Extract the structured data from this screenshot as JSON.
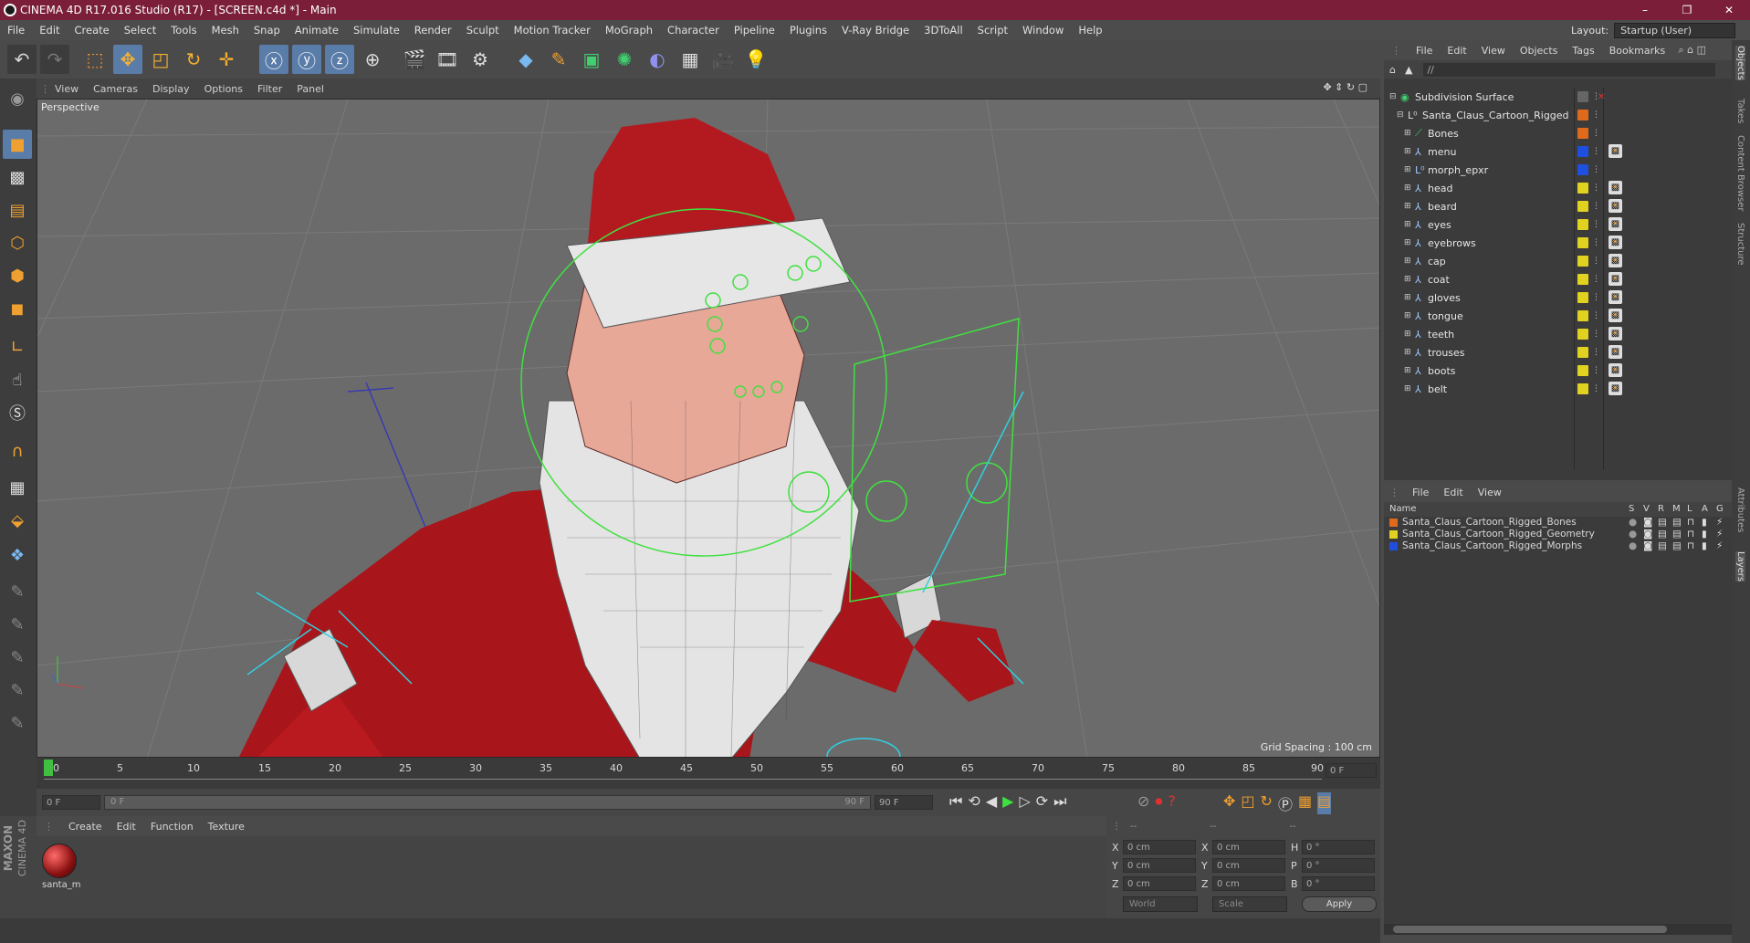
{
  "window": {
    "title": "CINEMA 4D R17.016 Studio (R17) - [SCREEN.c4d *] - Main",
    "controls": [
      "–",
      "❐",
      "✕"
    ]
  },
  "menubar": [
    "File",
    "Edit",
    "Create",
    "Select",
    "Tools",
    "Mesh",
    "Snap",
    "Animate",
    "Simulate",
    "Render",
    "Sculpt",
    "Motion Tracker",
    "MoGraph",
    "Character",
    "Pipeline",
    "Plugins",
    "V-Ray Bridge",
    "3DToAll",
    "Script",
    "Window",
    "Help"
  ],
  "layout": {
    "label": "Layout:",
    "value": "Startup (User)"
  },
  "viewport": {
    "menu": [
      "View",
      "Cameras",
      "Display",
      "Options",
      "Filter",
      "Panel"
    ],
    "camera_label": "Perspective",
    "grid_spacing": "Grid Spacing : 100 cm"
  },
  "timeline": {
    "ticks": [
      "0",
      "5",
      "10",
      "15",
      "20",
      "25",
      "30",
      "35",
      "40",
      "45",
      "50",
      "55",
      "60",
      "65",
      "70",
      "75",
      "80",
      "85",
      "90"
    ],
    "current_frame": "0 F",
    "start_frame": "0 F",
    "range_start": "0 F",
    "range_end": "90 F",
    "end_frame": "90 F"
  },
  "material_panel": {
    "menu": [
      "Create",
      "Edit",
      "Function",
      "Texture"
    ],
    "materials": [
      {
        "name": "santa_m"
      }
    ]
  },
  "coord_panel": {
    "headers": [
      "--",
      "--",
      "--"
    ],
    "rows": [
      {
        "a": "X",
        "av": "0 cm",
        "b": "X",
        "bv": "0 cm",
        "c": "H",
        "cv": "0 °"
      },
      {
        "a": "Y",
        "av": "0 cm",
        "b": "Y",
        "bv": "0 cm",
        "c": "P",
        "cv": "0 °"
      },
      {
        "a": "Z",
        "av": "0 cm",
        "b": "Z",
        "bv": "0 cm",
        "c": "B",
        "cv": "0 °"
      }
    ],
    "space": "World",
    "mode": "Scale",
    "apply": "Apply"
  },
  "object_manager": {
    "menu": [
      "File",
      "Edit",
      "View",
      "Objects",
      "Tags",
      "Bookmarks"
    ],
    "path": "//",
    "objects": [
      {
        "name": "Subdivision Surface",
        "indent": 0,
        "color": "#4a4a4a"
      },
      {
        "name": "Santa_Claus_Cartoon_Rigged",
        "indent": 1,
        "color": "#e06a1c"
      },
      {
        "name": "Bones",
        "indent": 2,
        "color": "#e06a1c"
      },
      {
        "name": "menu",
        "indent": 2,
        "color": "#1e4fe0"
      },
      {
        "name": "morph_epxr",
        "indent": 2,
        "color": "#1e4fe0"
      },
      {
        "name": "head",
        "indent": 2,
        "color": "#e0d21e"
      },
      {
        "name": "beard",
        "indent": 2,
        "color": "#e0d21e"
      },
      {
        "name": "eyes",
        "indent": 2,
        "color": "#e0d21e"
      },
      {
        "name": "eyebrows",
        "indent": 2,
        "color": "#e0d21e"
      },
      {
        "name": "cap",
        "indent": 2,
        "color": "#e0d21e"
      },
      {
        "name": "coat",
        "indent": 2,
        "color": "#e0d21e"
      },
      {
        "name": "gloves",
        "indent": 2,
        "color": "#e0d21e"
      },
      {
        "name": "tongue",
        "indent": 2,
        "color": "#e0d21e"
      },
      {
        "name": "teeth",
        "indent": 2,
        "color": "#e0d21e"
      },
      {
        "name": "trouses",
        "indent": 2,
        "color": "#e0d21e"
      },
      {
        "name": "boots",
        "indent": 2,
        "color": "#e0d21e"
      },
      {
        "name": "belt",
        "indent": 2,
        "color": "#e0d21e"
      }
    ]
  },
  "layer_manager": {
    "menu": [
      "File",
      "Edit",
      "View"
    ],
    "columns": [
      "Name",
      "S",
      "V",
      "R",
      "M",
      "L",
      "A",
      "G"
    ],
    "layers": [
      {
        "name": "Santa_Claus_Cartoon_Rigged_Bones",
        "color": "#e06a1c"
      },
      {
        "name": "Santa_Claus_Cartoon_Rigged_Geometry",
        "color": "#e0d21e"
      },
      {
        "name": "Santa_Claus_Cartoon_Rigged_Morphs",
        "color": "#1e4fe0"
      }
    ]
  },
  "right_tabs": [
    "Objects",
    "Takes",
    "Content Browser",
    "Structure",
    "Attributes",
    "Layers"
  ],
  "maxon": {
    "brand": "MAXON",
    "product": "CINEMA 4D"
  }
}
